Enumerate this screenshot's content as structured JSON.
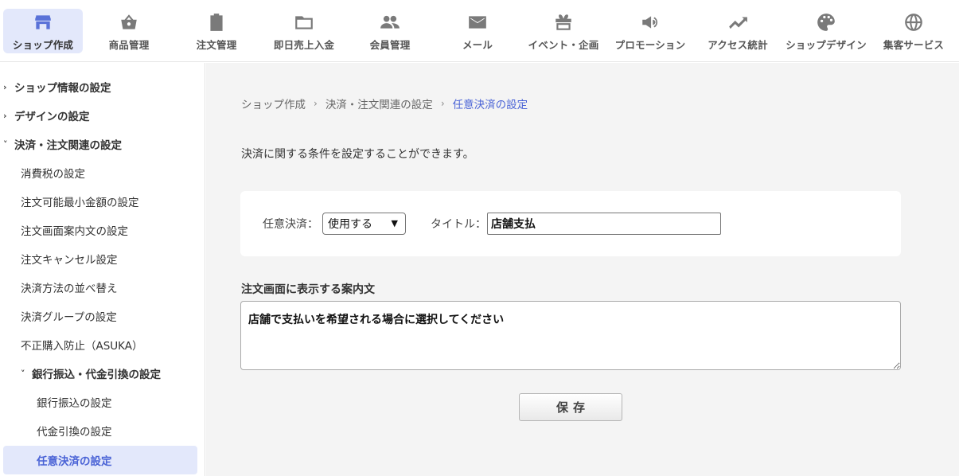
{
  "nav": {
    "items": [
      {
        "label": "ショップ作成",
        "icon": "shop-icon",
        "active": true
      },
      {
        "label": "商品管理",
        "icon": "basket-icon",
        "active": false
      },
      {
        "label": "注文管理",
        "icon": "clipboard-icon",
        "active": false
      },
      {
        "label": "即日売上入金",
        "icon": "folder-icon",
        "active": false
      },
      {
        "label": "会員管理",
        "icon": "people-icon",
        "active": false
      },
      {
        "label": "メール",
        "icon": "mail-icon",
        "active": false
      },
      {
        "label": "イベント・企画",
        "icon": "gift-icon",
        "active": false
      },
      {
        "label": "プロモーション",
        "icon": "megaphone-icon",
        "active": false
      },
      {
        "label": "アクセス統計",
        "icon": "trending-up-icon",
        "active": false
      },
      {
        "label": "ショップデザイン",
        "icon": "palette-icon",
        "active": false
      },
      {
        "label": "集客サービス",
        "icon": "globe-icon",
        "active": false
      }
    ]
  },
  "sidebar": {
    "items": [
      {
        "label": "ショップ情報の設定",
        "caret": "›",
        "level": "lvl0"
      },
      {
        "label": "デザインの設定",
        "caret": "›",
        "level": "lvl0"
      },
      {
        "label": "決済・注文関連の設定",
        "caret": "˅",
        "level": "lvl0"
      },
      {
        "label": "消費税の設定",
        "caret": "",
        "level": "lvl1"
      },
      {
        "label": "注文可能最小金額の設定",
        "caret": "",
        "level": "lvl1"
      },
      {
        "label": "注文画面案内文の設定",
        "caret": "",
        "level": "lvl1"
      },
      {
        "label": "注文キャンセル設定",
        "caret": "",
        "level": "lvl1"
      },
      {
        "label": "決済方法の並べ替え",
        "caret": "",
        "level": "lvl1"
      },
      {
        "label": "決済グループの設定",
        "caret": "",
        "level": "lvl1"
      },
      {
        "label": "不正購入防止（ASUKA）",
        "caret": "",
        "level": "lvl1"
      },
      {
        "label": "銀行振込・代金引換の設定",
        "caret": "˅",
        "level": "lvl1b"
      },
      {
        "label": "銀行振込の設定",
        "caret": "",
        "level": "lvl2"
      },
      {
        "label": "代金引換の設定",
        "caret": "",
        "level": "lvl2"
      },
      {
        "label": "任意決済の設定",
        "caret": "",
        "level": "active"
      }
    ]
  },
  "breadcrumb": {
    "items": [
      "ショップ作成",
      "決済・注文関連の設定",
      "任意決済の設定"
    ],
    "separator": "›"
  },
  "description": "決済に関する条件を設定することができます。",
  "form": {
    "payment_label": "任意決済：",
    "payment_value": "使用する",
    "title_label": "タイトル：",
    "title_value": "店舗支払",
    "guide_label": "注文画面に表示する案内文",
    "guide_value": "店舗で支払いを希望される場合に選択してください",
    "save_label": "保存"
  },
  "colors": {
    "accent": "#4a63d6",
    "active_bg": "#e3e8fb",
    "main_bg": "#f4f4f4"
  }
}
